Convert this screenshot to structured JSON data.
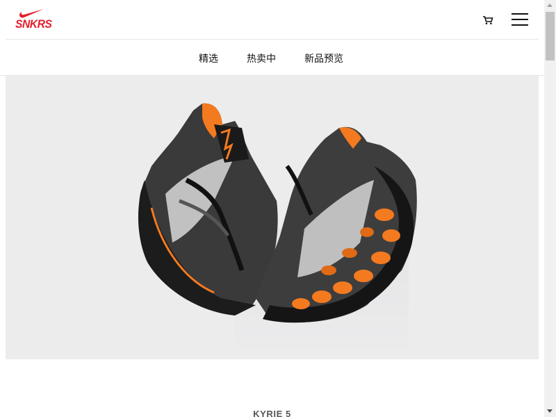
{
  "header": {
    "brand_text": "SNKRS",
    "brand_color": "#e41e2b",
    "icons": {
      "logo": "nike-swoosh-icon",
      "cart": "cart-icon",
      "menu": "hamburger-menu-icon"
    }
  },
  "nav": {
    "items": [
      {
        "label": "精选"
      },
      {
        "label": "热卖中"
      },
      {
        "label": "新品预览"
      }
    ]
  },
  "hero": {
    "image_description": "product-image",
    "accent_color": "#f47a20"
  },
  "product": {
    "title": "KYRIE 5"
  }
}
